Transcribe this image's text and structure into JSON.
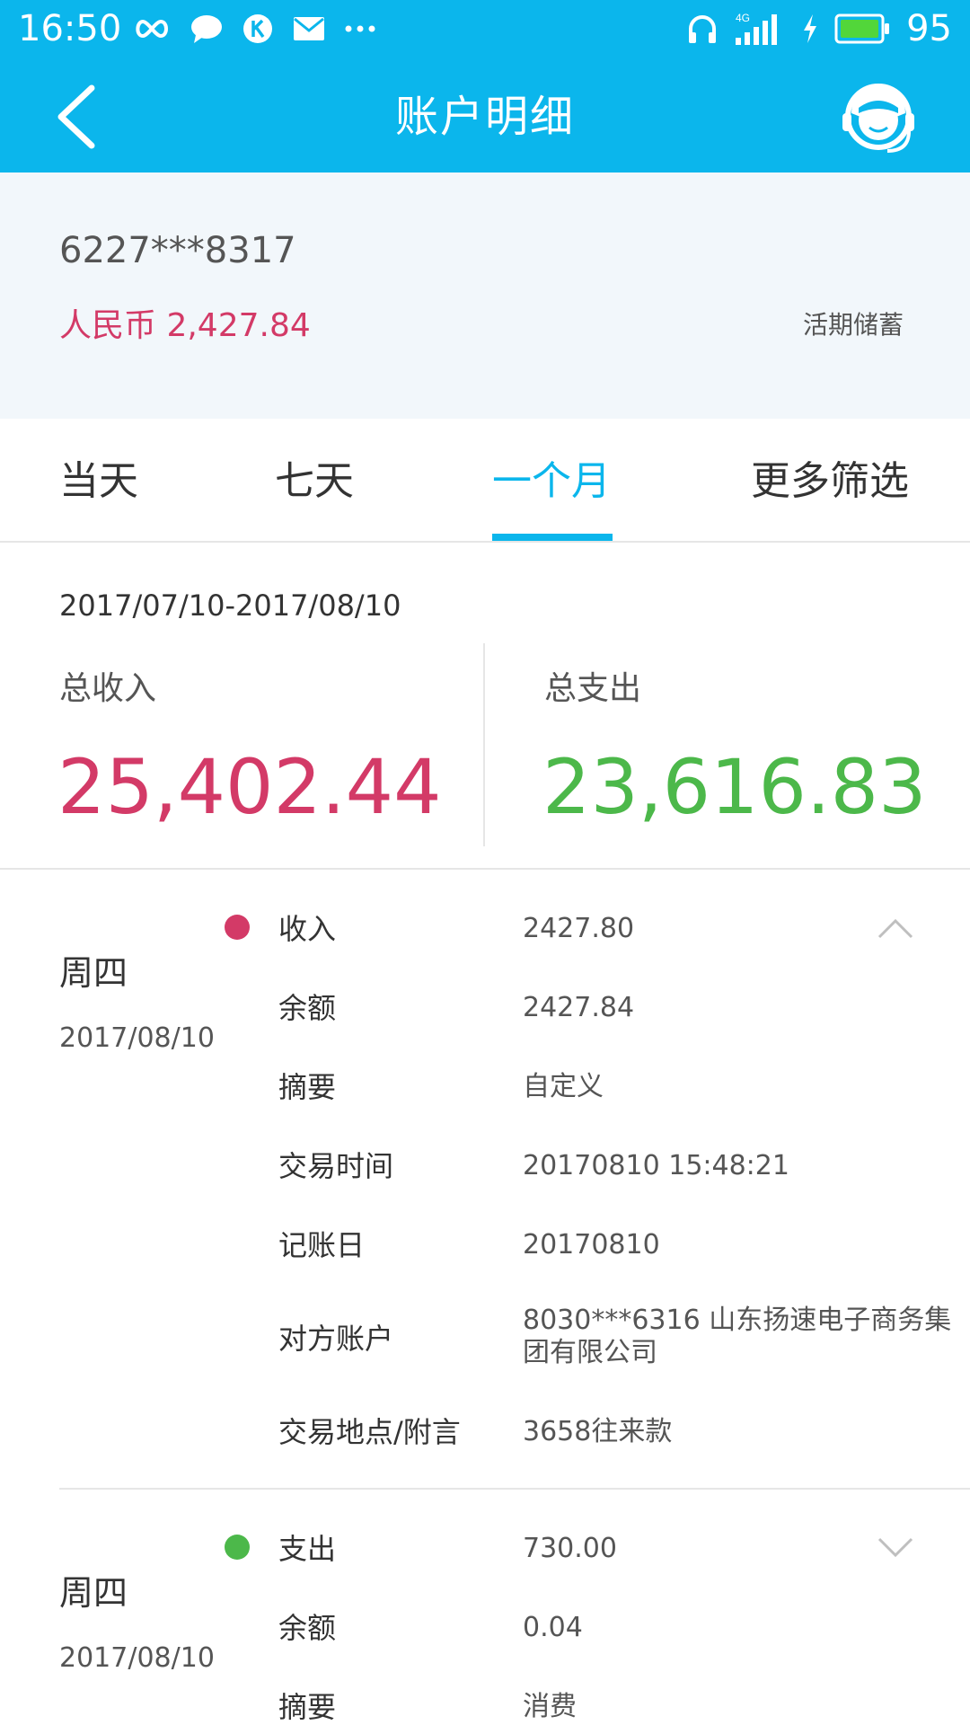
{
  "status_bar": {
    "time": "16:50",
    "battery": "95",
    "icons_left": [
      "infinity-icon",
      "chat-bubble-icon",
      "k-app-icon",
      "mail-icon",
      "more-dots-icon"
    ],
    "icons_right": [
      "headphones-icon",
      "4g-signal-icon",
      "charging-icon",
      "battery-icon"
    ]
  },
  "nav": {
    "title": "账户明细",
    "back_icon": "chevron-left-icon",
    "service_icon": "customer-service-icon"
  },
  "account": {
    "number": "6227***8317",
    "balance": "人民币 2,427.84",
    "type": "活期储蓄"
  },
  "tabs": [
    {
      "label": "当天",
      "active": false
    },
    {
      "label": "七天",
      "active": false
    },
    {
      "label": "一个月",
      "active": true
    },
    {
      "label": "更多筛选",
      "active": false
    }
  ],
  "summary": {
    "date_range": "2017/07/10-2017/08/10",
    "income_label": "总收入",
    "income_value": "25,402.44",
    "expense_label": "总支出",
    "expense_value": "23,616.83"
  },
  "records": [
    {
      "weekday": "周四",
      "date": "2017/08/10",
      "type_label": "收入",
      "amount": "2427.80",
      "kind": "income",
      "expanded": true,
      "rows": [
        {
          "label": "余额",
          "value": "2427.84"
        },
        {
          "label": "摘要",
          "value": "自定义"
        },
        {
          "label": "交易时间",
          "value": "20170810 15:48:21"
        },
        {
          "label": "记账日",
          "value": "20170810"
        },
        {
          "label": "对方账户",
          "value": "8030***6316 山东扬速电子商务集团有限公司"
        },
        {
          "label": "交易地点/附言",
          "value": "3658往来款"
        }
      ]
    },
    {
      "weekday": "周四",
      "date": "2017/08/10",
      "type_label": "支出",
      "amount": "730.00",
      "kind": "expense",
      "expanded": false,
      "rows": [
        {
          "label": "余额",
          "value": "0.04"
        },
        {
          "label": "摘要",
          "value": "消费"
        }
      ]
    }
  ],
  "colors": {
    "brand": "#0bb6ec",
    "income": "#d33a67",
    "expense": "#4cb84a"
  }
}
